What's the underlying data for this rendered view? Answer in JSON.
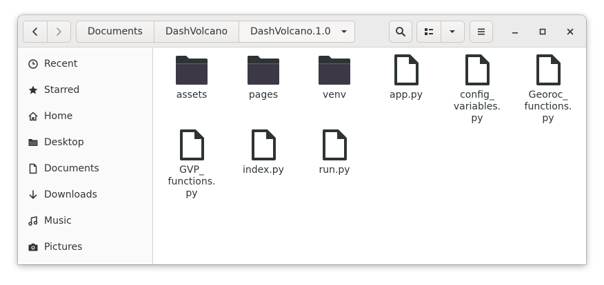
{
  "header": {
    "breadcrumbs": [
      "Documents",
      "DashVolcano",
      "DashVolcano.1.0"
    ],
    "buttons": {
      "back": "back-icon",
      "forward": "forward-icon",
      "search": "search-icon",
      "view_toggle": "list-view-icon",
      "view_options": "chevron-down-icon",
      "menu": "hamburger-menu-icon",
      "minimize": "minimize-icon",
      "maximize": "maximize-icon",
      "close": "close-icon"
    }
  },
  "sidebar": {
    "items": [
      {
        "label": "Recent",
        "icon": "clock-icon"
      },
      {
        "label": "Starred",
        "icon": "star-icon"
      },
      {
        "label": "Home",
        "icon": "home-icon"
      },
      {
        "label": "Desktop",
        "icon": "folder-icon"
      },
      {
        "label": "Documents",
        "icon": "document-icon"
      },
      {
        "label": "Downloads",
        "icon": "download-icon"
      },
      {
        "label": "Music",
        "icon": "music-icon"
      },
      {
        "label": "Pictures",
        "icon": "camera-icon"
      }
    ]
  },
  "files": [
    {
      "name": "assets",
      "type": "folder"
    },
    {
      "name": "pages",
      "type": "folder"
    },
    {
      "name": "venv",
      "type": "folder"
    },
    {
      "name": "app.py",
      "type": "file"
    },
    {
      "name": "config_\nvariables.\npy",
      "type": "file"
    },
    {
      "name": "Georoc_\nfunctions.\npy",
      "type": "file"
    },
    {
      "name": "GVP_\nfunctions.\npy",
      "type": "file"
    },
    {
      "name": "index.py",
      "type": "file"
    },
    {
      "name": "run.py",
      "type": "file"
    }
  ]
}
